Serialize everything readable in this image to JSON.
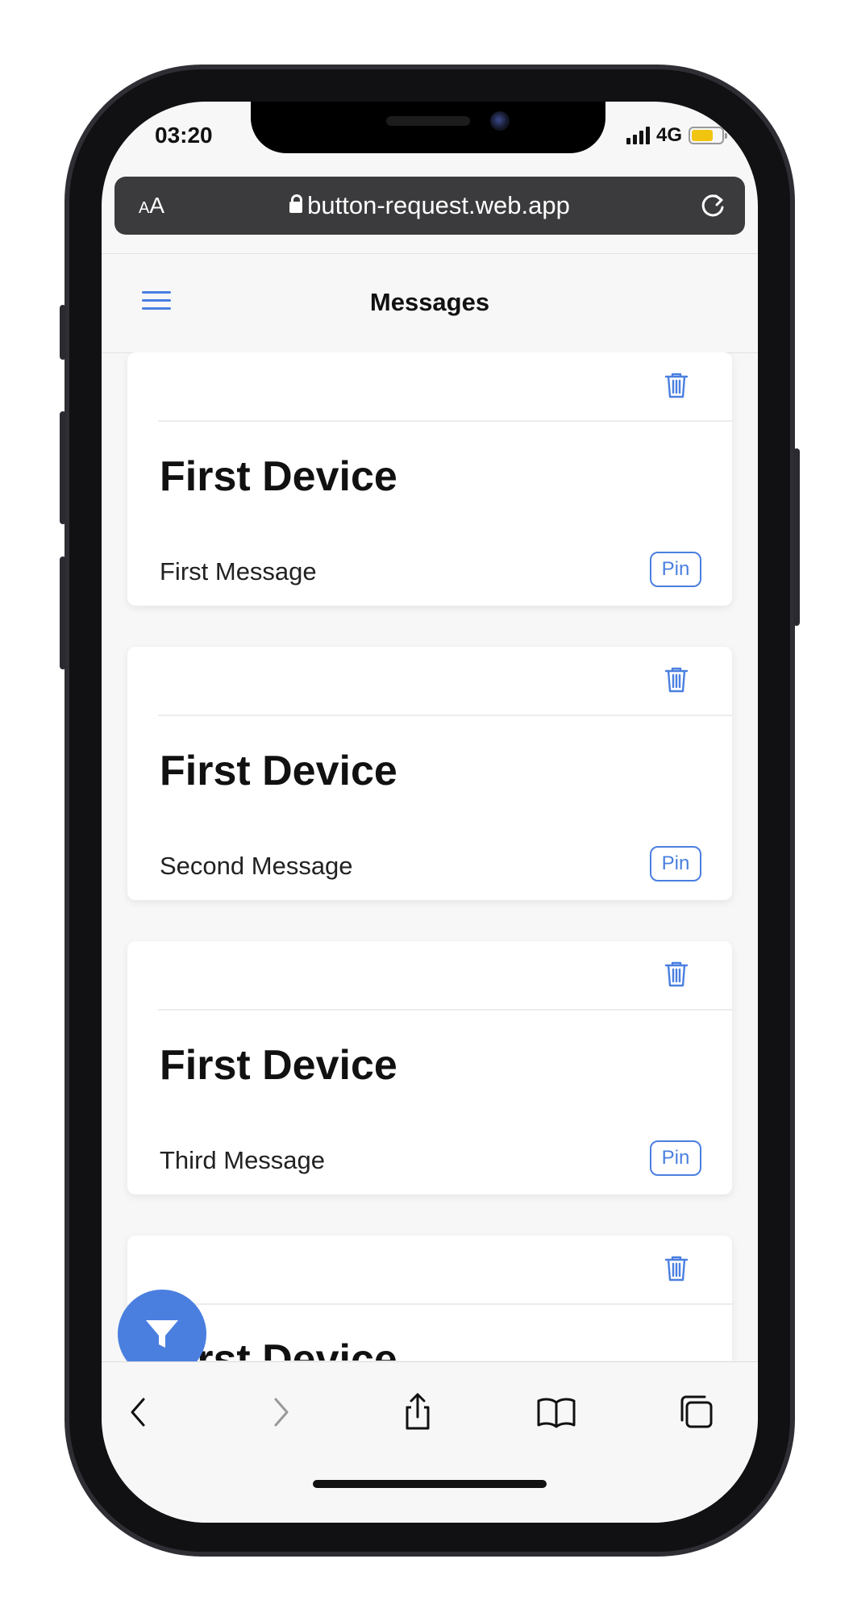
{
  "status_bar": {
    "time": "03:20",
    "network": "4G"
  },
  "browser": {
    "text_size_label": "AA",
    "url": "button-request.web.app"
  },
  "app_bar": {
    "title": "Messages"
  },
  "messages": [
    {
      "device": "First Device",
      "text": "First Message",
      "pin_label": "Pin"
    },
    {
      "device": "First Device",
      "text": "Second Message",
      "pin_label": "Pin"
    },
    {
      "device": "First Device",
      "text": "Third Message",
      "pin_label": "Pin"
    },
    {
      "device": "First Device",
      "text": "",
      "pin_label": ""
    }
  ],
  "icons": {
    "menu": "hamburger-icon",
    "delete": "trash-icon",
    "filter": "filter-icon",
    "back": "chevron-left-icon",
    "forward": "chevron-right-icon",
    "share": "share-icon",
    "bookmarks": "book-icon",
    "tabs": "tabs-icon"
  },
  "colors": {
    "accent": "#4a7fe0",
    "url_bar": "#3b3b3d",
    "battery": "#f1c40f"
  }
}
